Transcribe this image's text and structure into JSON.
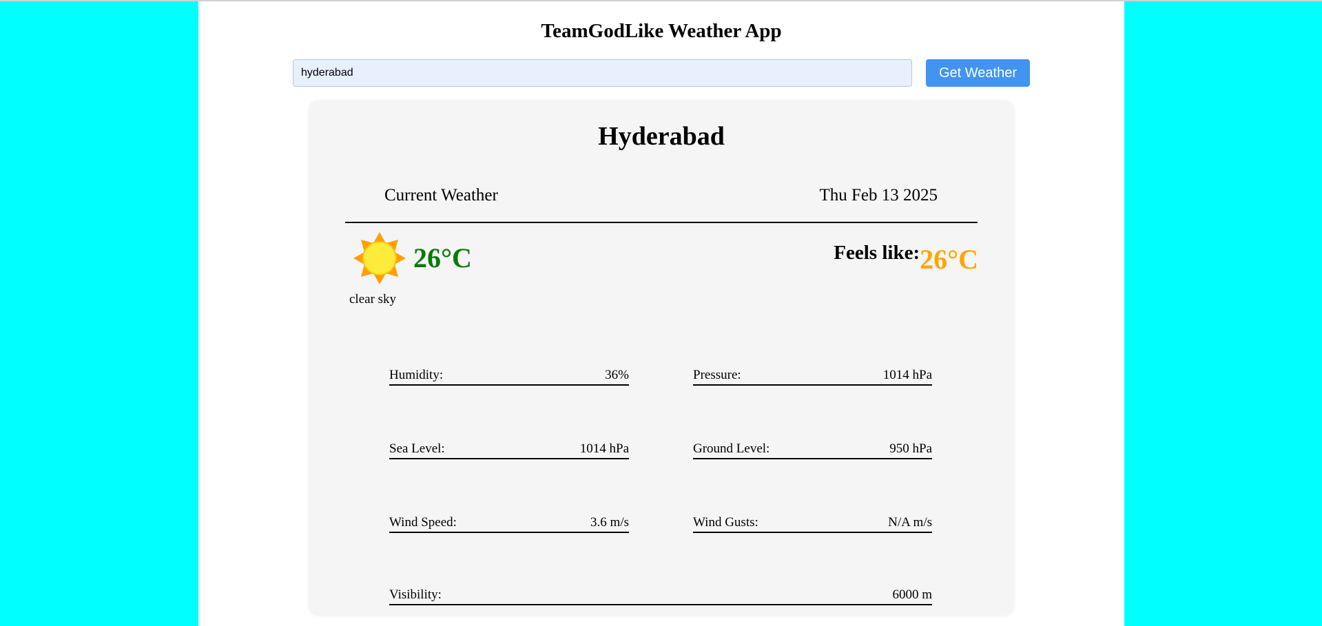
{
  "app": {
    "title": "TeamGodLike Weather App"
  },
  "search": {
    "value": "hyderabad",
    "button_label": "Get Weather"
  },
  "weather": {
    "city": "Hyderabad",
    "section_label": "Current Weather",
    "date": "Thu Feb 13 2025",
    "icon": "sun-icon",
    "temperature": "26°C",
    "condition": "clear sky",
    "feels_like_label": "Feels like:",
    "feels_like_value": "26°C",
    "metrics": {
      "humidity": {
        "label": "Humidity:",
        "value": "36%"
      },
      "pressure": {
        "label": "Pressure:",
        "value": "1014 hPa"
      },
      "sea_level": {
        "label": "Sea Level:",
        "value": "1014 hPa"
      },
      "ground_level": {
        "label": "Ground Level:",
        "value": "950 hPa"
      },
      "wind_speed": {
        "label": "Wind Speed:",
        "value": "3.6 m/s"
      },
      "wind_gusts": {
        "label": "Wind Gusts:",
        "value": "N/A m/s"
      },
      "visibility": {
        "label": "Visibility:",
        "value": "6000 m"
      }
    }
  },
  "colors": {
    "page_background": "#00ffff",
    "button": "#4294f0",
    "temperature": "#0a7a0a",
    "feels_like": "#ffa500"
  }
}
